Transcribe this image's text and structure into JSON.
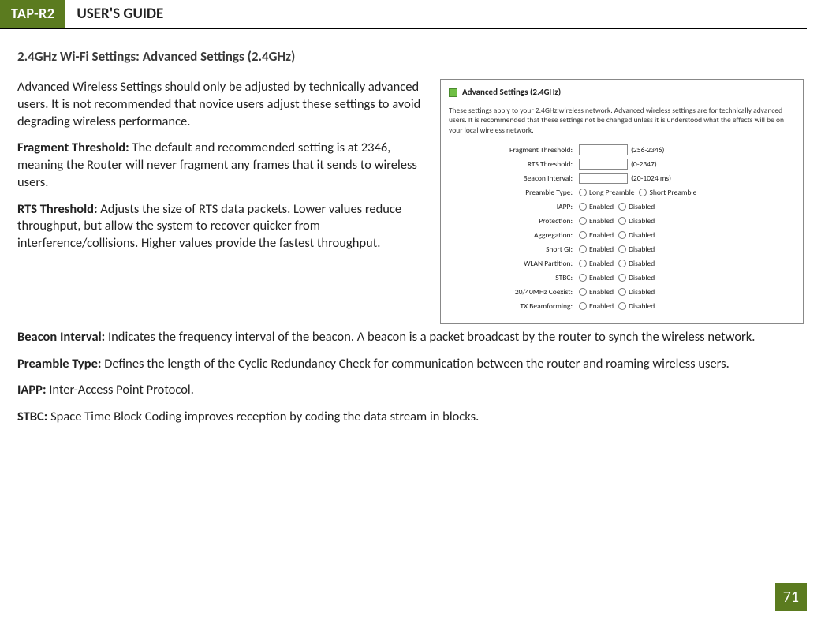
{
  "header": {
    "badge": "TAP-R2",
    "title": "USER'S GUIDE"
  },
  "section_heading": "2.4GHz Wi-Fi Settings: Advanced Settings (2.4GHz)",
  "intro": "Advanced Wireless Settings should only be adjusted by technically advanced users. It is not recommended that novice users adjust these settings to avoid degrading wireless performance.",
  "frag_label": "Fragment Threshold:",
  "frag_text": " The default and recommended setting is at 2346, meaning the Router will never fragment any frames that it sends to wireless users.",
  "rts_label": "RTS Threshold:",
  "rts_text": " Adjusts the size of RTS data packets. Lower values reduce throughput, but allow the system to recover quicker from interference/collisions. Higher values provide the fastest throughput.",
  "beacon_label": "Beacon Interval:",
  "beacon_text": " Indicates the frequency interval of the beacon. A beacon is a packet broadcast by the router to synch the wireless network.",
  "preamble_label": "Preamble Type:",
  "preamble_text": " Defines the length of the Cyclic Redundancy Check for communication between the router and roaming wireless users.",
  "iapp_label": "IAPP:",
  "iapp_text": " Inter-Access Point Protocol.",
  "stbc_label": "STBC:",
  "stbc_text": " Space Time Block Coding improves reception by coding the data stream in blocks.",
  "panel": {
    "title": "Advanced Settings (2.4GHz)",
    "desc": "These settings apply to your 2.4GHz wireless network. Advanced wireless settings are for technically advanced users. It is recommended that these settings not be changed unless it is understood what the effects will be on your local wireless network.",
    "rows": {
      "frag": {
        "label": "Fragment Threshold:",
        "hint": "(256-2346)"
      },
      "rts": {
        "label": "RTS Threshold:",
        "hint": "(0-2347)"
      },
      "beacon": {
        "label": "Beacon Interval:",
        "hint": "(20-1024 ms)"
      },
      "preamble": {
        "label": "Preamble Type:",
        "opt1": "Long Preamble",
        "opt2": "Short Preamble"
      },
      "iapp": {
        "label": "IAPP:"
      },
      "protection": {
        "label": "Protection:"
      },
      "aggregation": {
        "label": "Aggregation:"
      },
      "shortgi": {
        "label": "Short GI:"
      },
      "wlan": {
        "label": "WLAN Partition:"
      },
      "stbc": {
        "label": "STBC:"
      },
      "coexist": {
        "label": "20/40MHz Coexist:"
      },
      "txbf": {
        "label": "TX Beamforming:"
      }
    },
    "enabled": "Enabled",
    "disabled": "Disabled"
  },
  "page_number": "71"
}
